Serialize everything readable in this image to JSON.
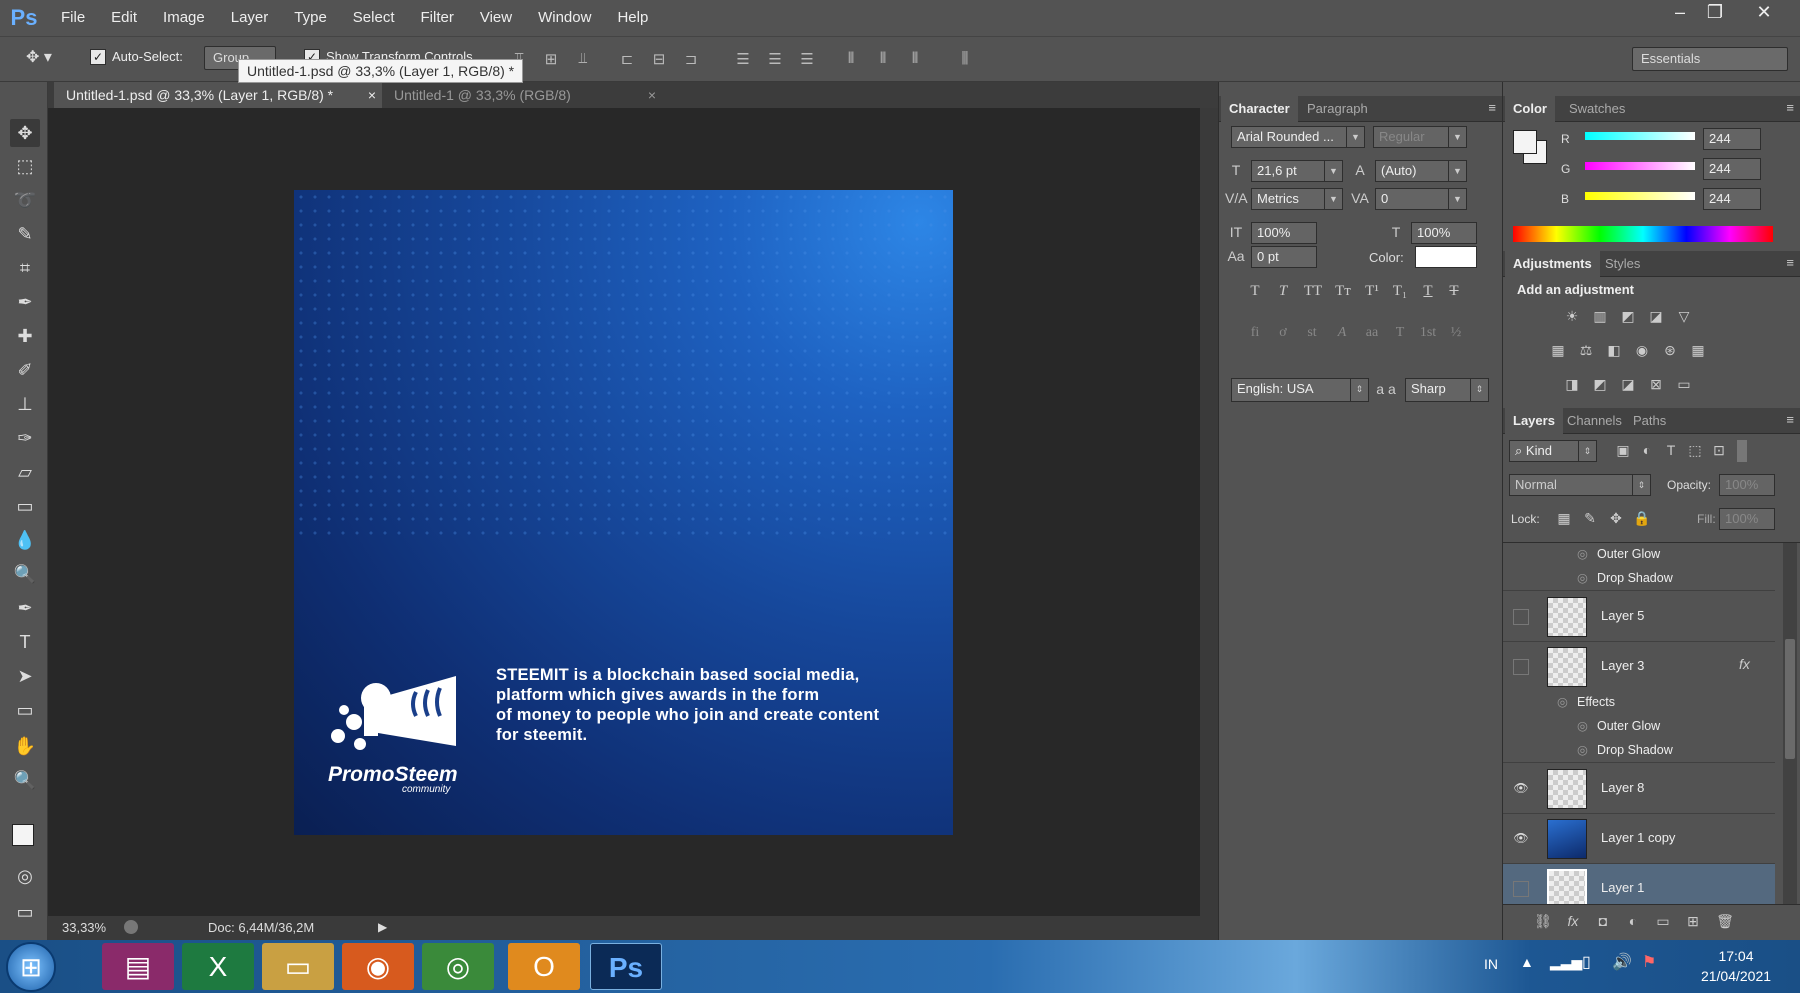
{
  "app": {
    "logo": "Ps"
  },
  "menu": [
    "File",
    "Edit",
    "Image",
    "Layer",
    "Type",
    "Select",
    "Filter",
    "View",
    "Window",
    "Help"
  ],
  "window_controls": {
    "minimize": "–",
    "restore": "❐",
    "close": "✕"
  },
  "options_bar": {
    "auto_select_label": "Auto-Select:",
    "auto_select_checked": true,
    "auto_select_value": "Group",
    "show_transform_label": "Show Transform Controls",
    "workspace": "Essentials"
  },
  "tooltip": "Untitled-1.psd @ 33,3% (Layer 1, RGB/8) *",
  "doc_tabs": [
    {
      "label": "Untitled-1.psd @ 33,3% (Layer 1, RGB/8) *",
      "close": "×",
      "active": true
    },
    {
      "label": "Untitled-1 @ 33,3% (RGB/8)",
      "close": "×",
      "active": false
    }
  ],
  "document": {
    "text_lines": [
      "STEEMIT is a blockchain based social media,",
      "platform which gives awards in the form",
      "of money to people who join and create content",
      "for steemit."
    ],
    "logo_name": "PromoSteem",
    "logo_sub": "community"
  },
  "status": {
    "zoom": "33,33%",
    "doc": "Doc: 6,44M/36,2M"
  },
  "character_panel": {
    "tabs": [
      "Character",
      "Paragraph"
    ],
    "font_family": "Arial Rounded ...",
    "font_style": "Regular",
    "font_size": "21,6 pt",
    "leading": "(Auto)",
    "kerning": "Metrics",
    "tracking": "0",
    "vscale": "100%",
    "hscale": "100%",
    "baseline": "0 pt",
    "color_label": "Color:",
    "language": "English: USA",
    "aa_icon": "a a",
    "antialias": "Sharp",
    "type_buttons": [
      "T",
      "T",
      "TT",
      "Tт",
      "T¹",
      "T₁",
      "T",
      "T"
    ],
    "ot_buttons": [
      "fi",
      "ơ",
      "st",
      "A",
      "aa",
      "T",
      "1st",
      "½"
    ]
  },
  "color_panel": {
    "tabs": [
      "Color",
      "Swatches"
    ],
    "channels": [
      {
        "label": "R",
        "value": "244"
      },
      {
        "label": "G",
        "value": "244"
      },
      {
        "label": "B",
        "value": "244"
      }
    ]
  },
  "adjustments_panel": {
    "tabs": [
      "Adjustments",
      "Styles"
    ],
    "title": "Add an adjustment"
  },
  "layers_panel": {
    "tabs": [
      "Layers",
      "Channels",
      "Paths"
    ],
    "kind": "Kind",
    "blend_mode": "Normal",
    "opacity_label": "Opacity:",
    "opacity": "100%",
    "lock_label": "Lock:",
    "fill_label": "Fill:",
    "fill": "100%",
    "top_effects": [
      "Outer Glow",
      "Drop Shadow"
    ],
    "layers": [
      {
        "name": "Layer 5",
        "visible": false
      },
      {
        "name": "Layer 3",
        "visible": false,
        "fx": "fx",
        "effects_label": "Effects",
        "effects": [
          "Outer Glow",
          "Drop Shadow"
        ]
      },
      {
        "name": "Layer 8",
        "visible": true
      },
      {
        "name": "Layer 1 copy",
        "visible": true
      },
      {
        "name": "Layer 1",
        "visible": false,
        "selected": true
      }
    ]
  },
  "taskbar": {
    "language": "IN",
    "time": "17:04",
    "date": "21/04/2021",
    "apps": [
      "winrar",
      "excel",
      "explorer",
      "firefox",
      "chrome",
      "outlook",
      "photoshop"
    ]
  },
  "colors": {
    "accent": "#6ab0ff",
    "selection": "#54697f",
    "taskbar": "#1a4f86"
  }
}
